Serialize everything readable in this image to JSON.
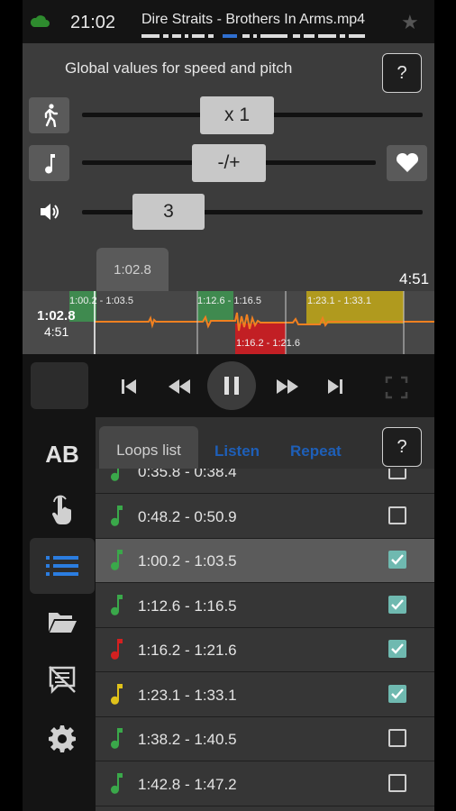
{
  "status": {
    "time": "21:02",
    "track": "Dire Straits - Brothers In Arms.mp4"
  },
  "global": {
    "title": "Global values for speed and pitch",
    "help": "?"
  },
  "speed": {
    "value": "x 1"
  },
  "pitch": {
    "value": "-/+"
  },
  "volume": {
    "value": "3"
  },
  "waveform": {
    "position_bubble": "1:02.8",
    "position": "1:02.8",
    "total": "4:51",
    "end": "4:51",
    "loops": [
      {
        "label": "1:00.2 - 1:03.5",
        "color": "#3f8a4f"
      },
      {
        "label": "1:12.6 - 1:16.5",
        "color": "#3f8a4f"
      },
      {
        "label": "1:16.2 - 1:21.6",
        "color": "#c21f24"
      },
      {
        "label": "1:23.1 - 1:33.1",
        "color": "#b09a1e"
      }
    ]
  },
  "tabs": {
    "loops": "Loops list",
    "listen": "Listen",
    "repeat": "Repeat",
    "help": "?"
  },
  "rail": {
    "ab": "AB"
  },
  "loops_list": [
    {
      "range": "0:35.8 - 0:38.4",
      "color": "#3aa84a",
      "checked": false,
      "selected": false
    },
    {
      "range": "0:48.2 - 0:50.9",
      "color": "#3aa84a",
      "checked": false,
      "selected": false
    },
    {
      "range": "1:00.2 - 1:03.5",
      "color": "#3aa84a",
      "checked": true,
      "selected": true
    },
    {
      "range": "1:12.6 - 1:16.5",
      "color": "#3aa84a",
      "checked": true,
      "selected": false
    },
    {
      "range": "1:16.2 - 1:21.6",
      "color": "#d42020",
      "checked": true,
      "selected": false
    },
    {
      "range": "1:23.1 - 1:33.1",
      "color": "#e0c21a",
      "checked": true,
      "selected": false
    },
    {
      "range": "1:38.2 - 1:40.5",
      "color": "#3aa84a",
      "checked": false,
      "selected": false
    },
    {
      "range": "1:42.8 - 1:47.2",
      "color": "#3aa84a",
      "checked": false,
      "selected": false
    }
  ],
  "colors": {
    "accent_tab": "#1e5fb8",
    "checkbox_on": "#6fb9b0",
    "wave": "#f08020"
  }
}
